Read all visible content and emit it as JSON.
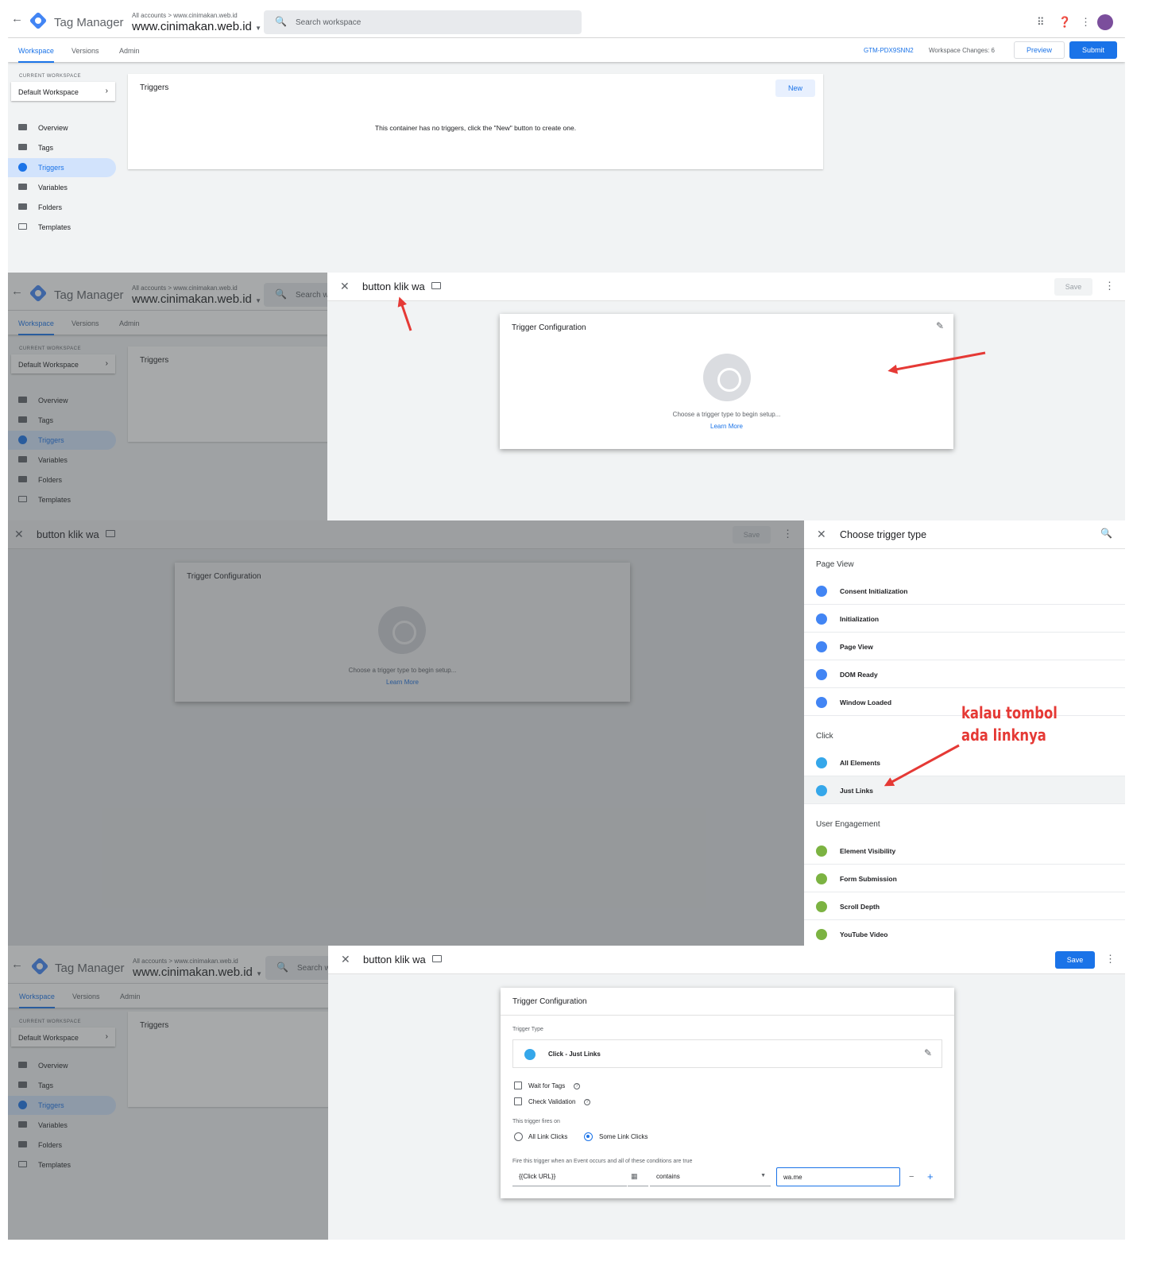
{
  "app": {
    "brand": "Tag Manager",
    "breadcrumb": "All accounts > www.cinimakan.web.id",
    "account": "www.cinimakan.web.id",
    "search_placeholder": "Search workspace",
    "search_placeholder_short": "Search w"
  },
  "tabs": [
    "Workspace",
    "Versions",
    "Admin"
  ],
  "header_right": {
    "container_id": "GTM-PDX9SNN2",
    "workspace_changes": "Workspace Changes: 6",
    "preview": "Preview",
    "submit": "Submit"
  },
  "sidebar": {
    "current_workspace_label": "CURRENT WORKSPACE",
    "workspace_name": "Default Workspace",
    "items": [
      "Overview",
      "Tags",
      "Triggers",
      "Variables",
      "Folders",
      "Templates"
    ],
    "active": "Triggers"
  },
  "triggers_card": {
    "title": "Triggers",
    "new_button": "New",
    "empty_message": "This container has no triggers, click the \"New\" button to create one."
  },
  "editor": {
    "trigger_name": "button klik wa",
    "save": "Save",
    "config_title": "Trigger Configuration",
    "choose_prompt": "Choose a trigger type to begin setup...",
    "learn_more": "Learn More"
  },
  "trigger_type_panel": {
    "title": "Choose trigger type",
    "groups": [
      {
        "name": "Page View",
        "items": [
          {
            "label": "Consent Initialization",
            "color": "#4285f4"
          },
          {
            "label": "Initialization",
            "color": "#4285f4"
          },
          {
            "label": "Page View",
            "color": "#4285f4"
          },
          {
            "label": "DOM Ready",
            "color": "#4285f4"
          },
          {
            "label": "Window Loaded",
            "color": "#4285f4"
          }
        ]
      },
      {
        "name": "Click",
        "items": [
          {
            "label": "All Elements",
            "color": "#35a7ea"
          },
          {
            "label": "Just Links",
            "color": "#35a7ea"
          }
        ]
      },
      {
        "name": "User Engagement",
        "items": [
          {
            "label": "Element Visibility",
            "color": "#7cb342"
          },
          {
            "label": "Form Submission",
            "color": "#7cb342"
          },
          {
            "label": "Scroll Depth",
            "color": "#7cb342"
          },
          {
            "label": "YouTube Video",
            "color": "#7cb342"
          }
        ]
      }
    ],
    "selected": "Just Links"
  },
  "annotation": {
    "line1": "kalau tombol",
    "line2": "ada linknya",
    "color": "#e53935"
  },
  "config_form": {
    "trigger_type_label": "Trigger Type",
    "trigger_type_value": "Click - Just Links",
    "wait_for_tags": "Wait for Tags",
    "check_validation": "Check Validation",
    "fires_on_label": "This trigger fires on",
    "all_link_clicks": "All Link Clicks",
    "some_link_clicks": "Some Link Clicks",
    "selected_fire": "Some Link Clicks",
    "condition_label": "Fire this trigger when an Event occurs and all of these conditions are true",
    "condition": {
      "variable": "{{Click URL}}",
      "operator": "contains",
      "value": "wa.me"
    },
    "remove": "−",
    "add": "+"
  }
}
